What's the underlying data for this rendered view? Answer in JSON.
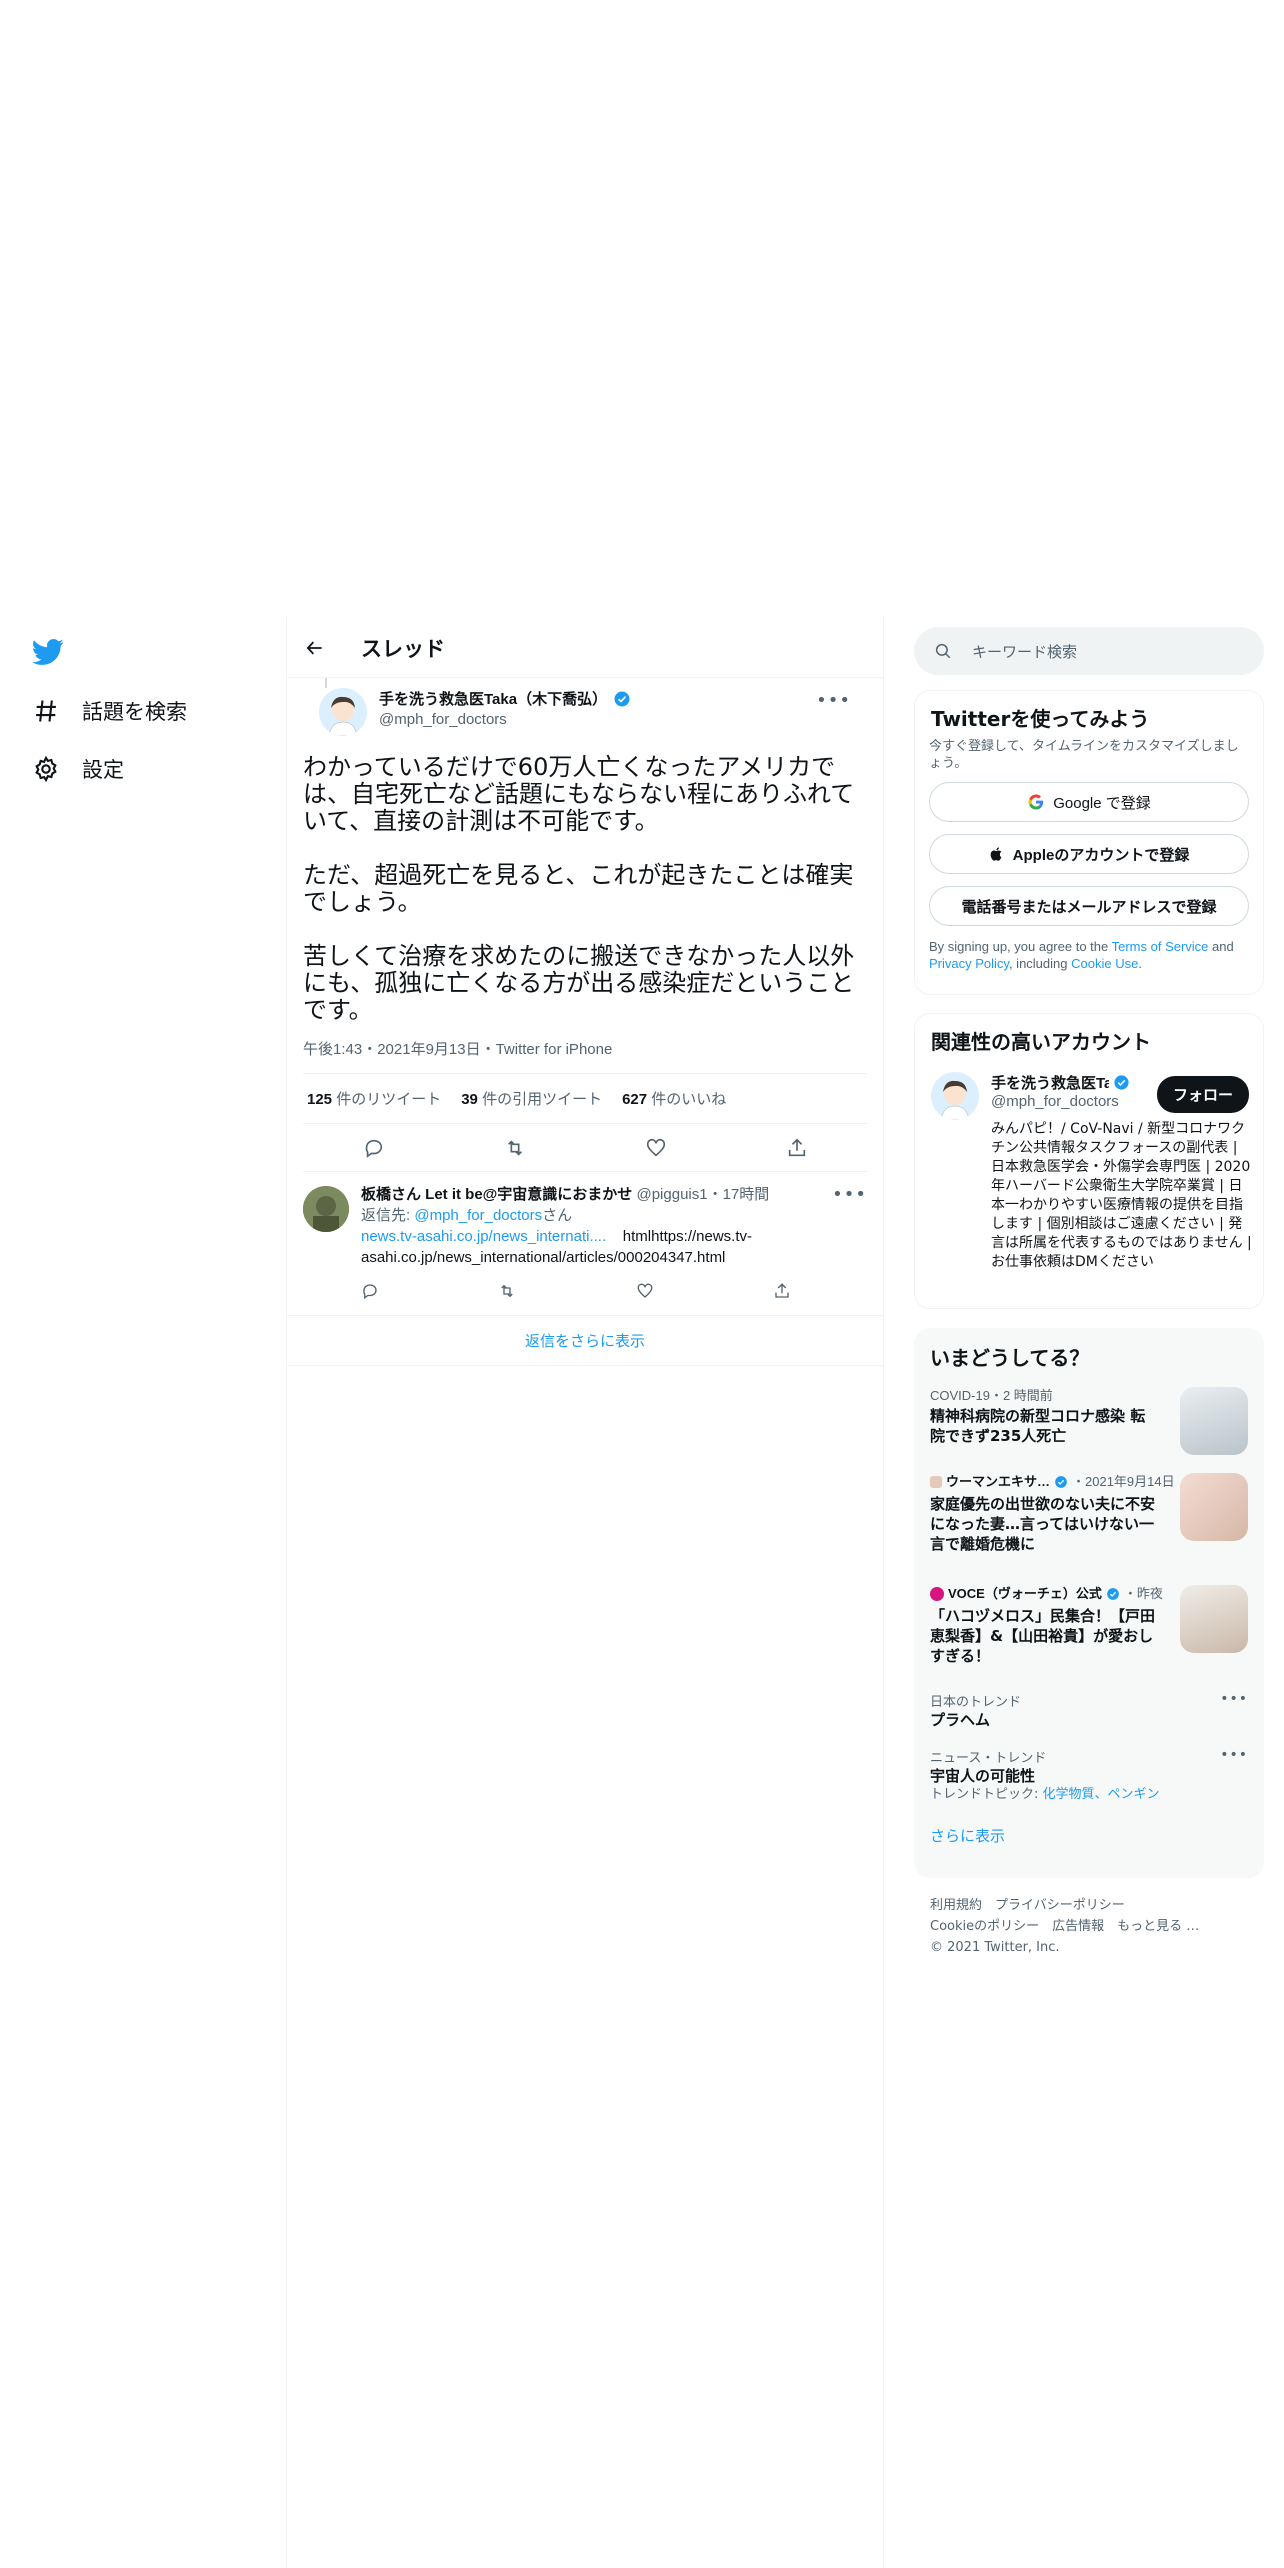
{
  "nav": {
    "explore_label": "話題を検索",
    "settings_label": "設定"
  },
  "thread": {
    "title": "スレッド",
    "author_name": "手を洗う救急医Taka（木下喬弘）",
    "author_handle": "@mph_for_doctors",
    "text": "わかっているだけで60万人亡くなったアメリカでは、自宅死亡など話題にもならない程にありふれていて、直接の計測は不可能です。\n\nただ、超過死亡を見ると、これが起きたことは確実でしょう。\n\n苦しくて治療を求めたのに搬送できなかった人以外にも、孤独に亡くなる方が出る感染症だということです。",
    "meta": "午後1:43・2021年9月13日・Twitter for iPhone",
    "retweets_count": "125",
    "retweets_label": "件のリツイート",
    "quotes_count": "39",
    "quotes_label": "件の引用ツイート",
    "likes_count": "627",
    "likes_label": "件のいいね",
    "more_icon": "•••"
  },
  "reply": {
    "author_name": "板橋さん Let it be@宇宙意識におまかせ",
    "author_handle": "@pigguis1",
    "time": "・17時間",
    "replying_to_label": "返信先: ",
    "replying_to_handle": "@mph_for_doctors",
    "replying_to_suffix": "さん",
    "link_text": "news.tv-asahi.co.jp/news_internati....",
    "body_text": "htmlhttps://news.tv-asahi.co.jp/news_international/articles/000204347.html"
  },
  "more_replies_label": "返信をさらに表示",
  "search": {
    "placeholder": "キーワード検索"
  },
  "signup": {
    "title": "Twitterを使ってみよう",
    "subtitle": "今すぐ登録して、タイムラインをカスタマイズしましょう。",
    "google_label": "Google で登録",
    "apple_label": "Appleのアカウントで登録",
    "phone_label": "電話番号またはメールアドレスで登録",
    "terms_prefix": "By signing up, you agree to the ",
    "terms_link": "Terms of Service",
    "terms_and": " and ",
    "privacy_link": "Privacy Policy",
    "including": ", including ",
    "cookie_link": "Cookie Use",
    "period": "."
  },
  "related": {
    "title": "関連性の高いアカウント",
    "name": "手を洗う救急医Taka",
    "handle": "@mph_for_doctors",
    "follow_label": "フォロー",
    "bio": "みんパピ！/ CoV-Navi / 新型コロナワクチン公共情報タスクフォースの副代表 | 日本救急医学会・外傷学会専門医 | 2020年ハーバード公衆衛生大学院卒業賞 | 日本一わかりやすい医療情報の提供を目指します | 個別相談はご遠慮ください | 発言は所属を代表するものではありません | お仕事依頼はDMください"
  },
  "trends": {
    "title": "いまどうしてる？",
    "items": [
      {
        "meta": "COVID-19・2 時間前",
        "title": "精神科病院の新型コロナ感染 転院できず235人死亡"
      },
      {
        "source": "ウーマンエキサ…",
        "meta": "・2021年9月14日",
        "title": "家庭優先の出世欲のない夫に不安になった妻…言ってはいけない一言で離婚危機に"
      },
      {
        "source": "VOCE（ヴォーチェ）公式",
        "meta": "・昨夜",
        "title": "「ハコヅメロス」民集合！【戸田恵梨香】&【山田裕貴】が愛おしすぎる！"
      },
      {
        "meta": "日本のトレンド",
        "title": "プラヘム"
      },
      {
        "meta": "ニュース・トレンド",
        "title": "宇宙人の可能性",
        "topics_label": "トレンドトピック: ",
        "topics": "化学物質、ペンギン"
      }
    ],
    "show_more": "さらに表示"
  },
  "footer": {
    "line1": "利用規約　プライバシーポリシー",
    "line2": "Cookieのポリシー　広告情報　もっと見る …",
    "line3": "© 2021 Twitter, Inc."
  },
  "colors": {
    "accent": "#1d9bf0",
    "text": "#0f1419",
    "muted": "#536471",
    "border": "#eff3f4"
  }
}
